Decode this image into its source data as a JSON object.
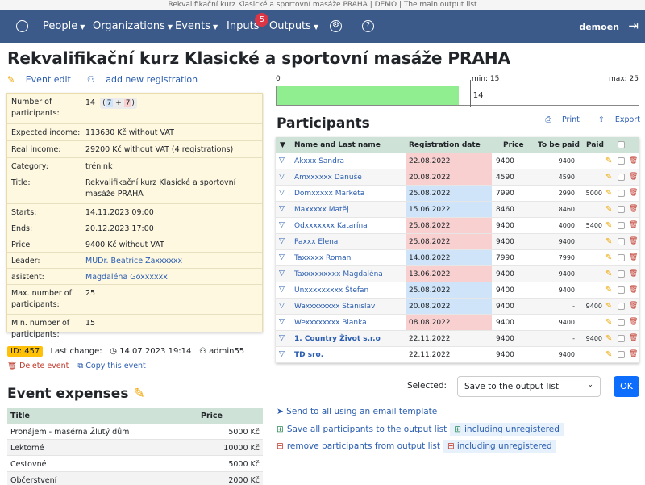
{
  "window_title": "Rekvalifikační kurz Klasické a sportovní masáže PRAHA | DEMO | The main output list",
  "nav": {
    "items": [
      {
        "label": "People",
        "has_caret": true
      },
      {
        "label": "Organizations",
        "has_caret": true
      },
      {
        "label": "Events",
        "has_caret": true
      },
      {
        "label": "Inputs",
        "has_caret": false,
        "badge": "5"
      },
      {
        "label": "Outputs",
        "has_caret": true
      }
    ],
    "user": "demoen"
  },
  "page_title": "Rekvalifikační kurz Klasické a sportovní masáže PRAHA",
  "top_links": {
    "edit": "Event edit",
    "add": "add new registration"
  },
  "info": {
    "participants_label": "Number of participants:",
    "participants_total": "14",
    "participants_a": "7",
    "participants_plus": "+",
    "participants_b": "7",
    "rows": [
      {
        "k": "Expected income:",
        "v": "113630 Kč without VAT",
        "link": false
      },
      {
        "k": "Real income:",
        "v": "29200 Kč without VAT (4 registrations)",
        "link": false
      },
      {
        "k": "Category:",
        "v": "trénink",
        "link": false
      },
      {
        "k": "Title:",
        "v": "Rekvalifikační kurz Klasické a sportovní masáže PRAHA",
        "link": false
      },
      {
        "k": "Starts:",
        "v": "14.11.2023 09:00",
        "link": false
      },
      {
        "k": "Ends:",
        "v": "20.12.2023 17:00",
        "link": false
      },
      {
        "k": "Price",
        "v": "9400 Kč without VAT",
        "link": false
      },
      {
        "k": "Leader:",
        "v": "MUDr. Beatrice Zaxxxxxx",
        "link": true
      },
      {
        "k": "asistent:",
        "v": "Magdaléna Goxxxxxx",
        "link": true
      },
      {
        "k": "Max. number of participants:",
        "v": "25",
        "link": false
      },
      {
        "k": "Min. number of participants:",
        "v": "15",
        "link": false
      }
    ]
  },
  "meta": {
    "id": "ID: 457",
    "last_change_label": "Last change:",
    "last_change": "14.07.2023 19:14",
    "user": "admin55",
    "delete": "Delete event",
    "copy": "Copy this event"
  },
  "expenses": {
    "title": "Event expenses",
    "headers": [
      "Title",
      "Price"
    ],
    "rows": [
      {
        "title": "Pronájem - masérna Žlutý dům",
        "price": "5000 Kč"
      },
      {
        "title": "Lektorné",
        "price": "10000 Kč"
      },
      {
        "title": "Cestovné",
        "price": "5000 Kč"
      },
      {
        "title": "Občerstvení",
        "price": "2000 Kč"
      }
    ]
  },
  "progress": {
    "start": "0",
    "min_label": "min: 15",
    "max_label": "max: 25",
    "value": "14",
    "fill_fraction": 0.504,
    "min_fraction": 0.534
  },
  "participants": {
    "title": "Participants",
    "print": "Print",
    "export": "Export",
    "headers": {
      "name": "Name and Last name",
      "date": "Registration date",
      "price": "Price",
      "to_be_paid": "To be paid",
      "paid": "Paid"
    },
    "rows": [
      {
        "name": "Akxxx Sandra",
        "date": "22.08.2022",
        "dc": "red",
        "price": "9400",
        "tbp": "9400",
        "paid": "",
        "bold": false
      },
      {
        "name": "Amxxxxxx Danuše",
        "date": "20.08.2022",
        "dc": "red",
        "price": "4590",
        "tbp": "4590",
        "paid": "",
        "bold": false
      },
      {
        "name": "Domxxxxx Markéta",
        "date": "25.08.2022",
        "dc": "blue",
        "price": "7990",
        "tbp": "2990",
        "paid": "5000",
        "bold": false
      },
      {
        "name": "Maxxxxx Matěj",
        "date": "15.06.2022",
        "dc": "blue",
        "price": "8460",
        "tbp": "8460",
        "paid": "",
        "bold": false
      },
      {
        "name": "Odxxxxxxx Katarína",
        "date": "25.08.2022",
        "dc": "red",
        "price": "9400",
        "tbp": "4000",
        "paid": "5400",
        "bold": false
      },
      {
        "name": "Paxxx Elena",
        "date": "25.08.2022",
        "dc": "red",
        "price": "9400",
        "tbp": "9400",
        "paid": "",
        "bold": false
      },
      {
        "name": "Taxxxxx Roman",
        "date": "14.08.2022",
        "dc": "blue",
        "price": "7990",
        "tbp": "7990",
        "paid": "",
        "bold": false
      },
      {
        "name": "Taxxxxxxxxx Magdaléna",
        "date": "13.06.2022",
        "dc": "red",
        "price": "9400",
        "tbp": "9400",
        "paid": "",
        "bold": false
      },
      {
        "name": "Unxxxxxxxxx Štefan",
        "date": "25.08.2022",
        "dc": "blue",
        "price": "9400",
        "tbp": "9400",
        "paid": "",
        "bold": false
      },
      {
        "name": "Waxxxxxxxx Stanislav",
        "date": "20.08.2022",
        "dc": "blue",
        "price": "9400",
        "tbp": "-",
        "paid": "9400",
        "bold": false
      },
      {
        "name": "Wexxxxxxxx Blanka",
        "date": "08.08.2022",
        "dc": "red",
        "price": "9400",
        "tbp": "9400",
        "paid": "",
        "bold": false
      },
      {
        "name": "1. Country Život s.r.o",
        "date": "22.11.2022",
        "dc": "",
        "price": "9400",
        "tbp": "-",
        "paid": "9400",
        "bold": true
      },
      {
        "name": "TD sro.",
        "date": "22.11.2022",
        "dc": "",
        "price": "9400",
        "tbp": "9400",
        "paid": "",
        "bold": true
      }
    ]
  },
  "actions": {
    "selected_label": "Selected:",
    "select_value": "Save to the output list",
    "ok": "OK",
    "send_all": "Send to all using an email template",
    "save_all": "Save all participants to the output list",
    "including_unregistered_1": "including unregistered",
    "remove": "remove participants from output list",
    "including_unregistered_2": "including unregistered"
  }
}
